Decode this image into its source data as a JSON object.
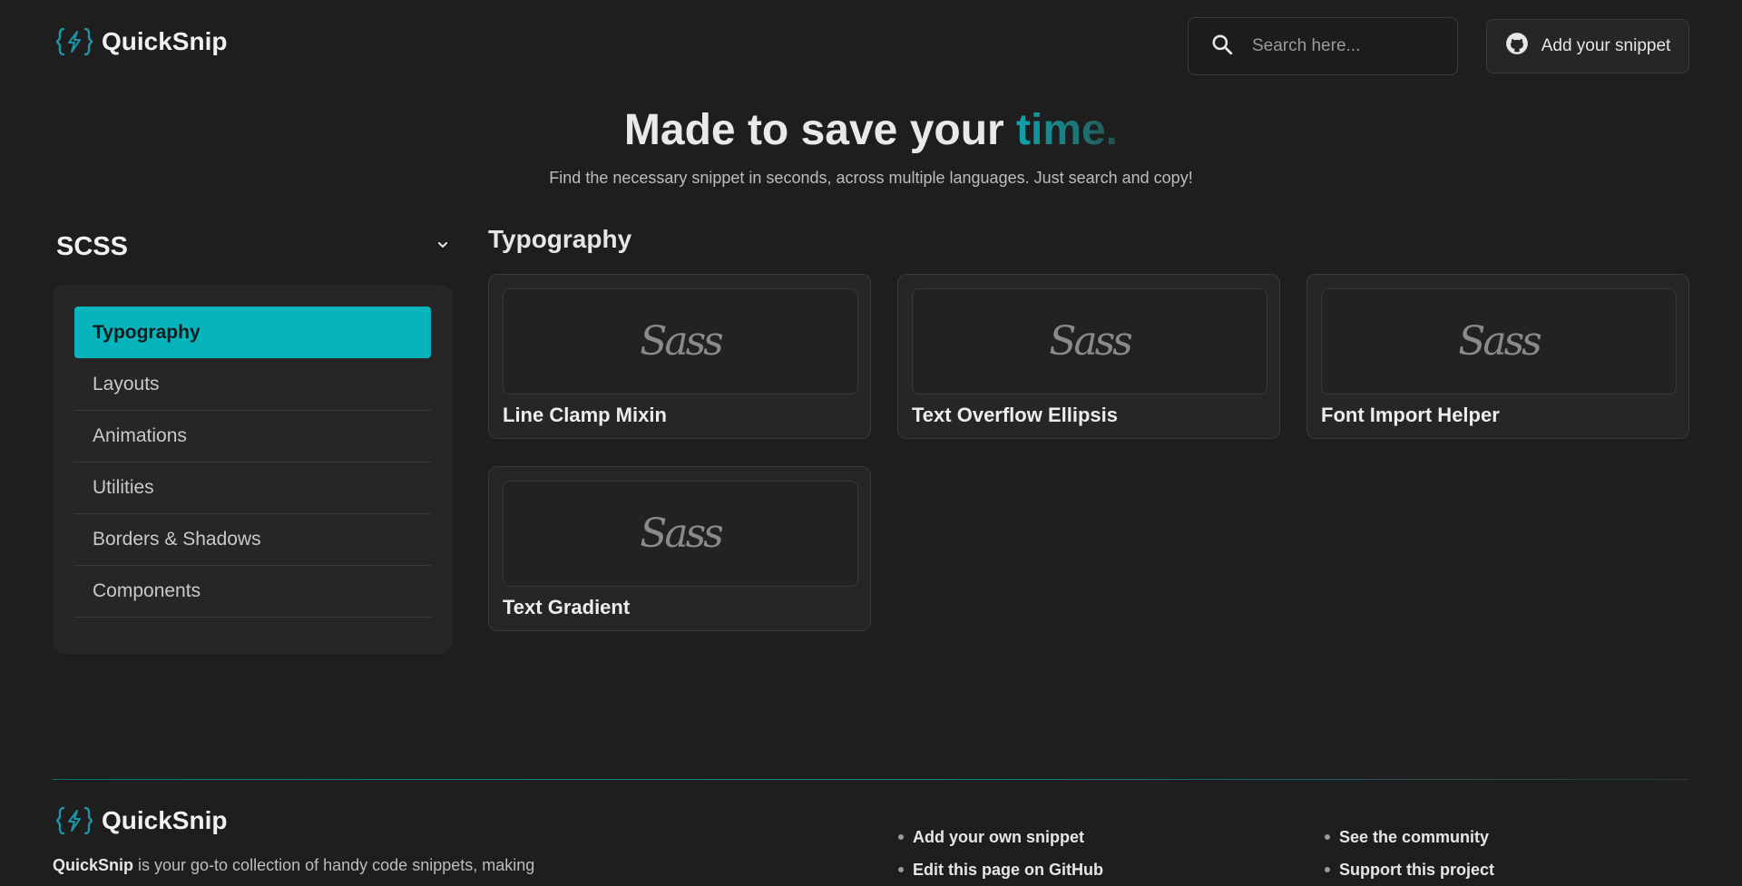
{
  "brand": {
    "name": "QuickSnip",
    "logo_icon": "code-bolt-icon",
    "accent_color": "#08b4bc"
  },
  "header": {
    "search": {
      "placeholder": "Search here...",
      "value": ""
    },
    "add_button_label": "Add your snippet",
    "add_button_icon": "github-icon"
  },
  "hero": {
    "title_prefix": "Made to save your ",
    "title_accent": "time.",
    "subtitle": "Find the necessary snippet in seconds, across multiple languages. Just search and copy!"
  },
  "sidebar": {
    "language": "SCSS",
    "categories": [
      {
        "label": "Typography",
        "active": true
      },
      {
        "label": "Layouts",
        "active": false
      },
      {
        "label": "Animations",
        "active": false
      },
      {
        "label": "Utilities",
        "active": false
      },
      {
        "label": "Borders & Shadows",
        "active": false
      },
      {
        "label": "Components",
        "active": false
      }
    ]
  },
  "main": {
    "section_title": "Typography",
    "thumb_logo_text": "Sass",
    "cards": [
      {
        "title": "Line Clamp Mixin"
      },
      {
        "title": "Text Overflow Ellipsis"
      },
      {
        "title": "Font Import Helper"
      },
      {
        "title": "Text Gradient"
      }
    ]
  },
  "footer": {
    "brand": "QuickSnip",
    "desc_brand": "QuickSnip",
    "desc_rest": " is your go-to collection of handy code snippets, making",
    "links_col1": [
      "Add your own snippet",
      "Edit this page on GitHub"
    ],
    "links_col2": [
      "See the community",
      "Support this project"
    ]
  }
}
